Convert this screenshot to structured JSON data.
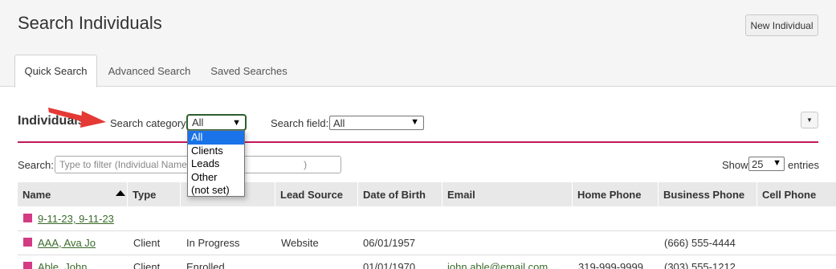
{
  "header": {
    "title": "Search Individuals",
    "new_button": "New Individual"
  },
  "tabs": [
    "Quick Search",
    "Advanced Search",
    "Saved Searches"
  ],
  "section": {
    "title": "Individuals",
    "category_label": "Search category:",
    "category_value": "All",
    "field_label": "Search field:",
    "field_value": "All"
  },
  "category_options": [
    "All",
    "Clients",
    "Leads",
    "Other",
    "(not set)"
  ],
  "filter": {
    "label": "Search:",
    "placeholder_visible_start": "Type to filter (Individual Name,",
    "placeholder_visible_end": ")",
    "show_label": "Show",
    "entries_value": "25",
    "entries_label": "entries"
  },
  "columns": [
    "Name",
    "Type",
    "",
    "Lead Source",
    "Date of Birth",
    "Email",
    "Home Phone",
    "Business Phone",
    "Cell Phone"
  ],
  "rows": [
    {
      "name": "9-11-23, 9-11-23",
      "type": "",
      "status": "",
      "lead_source": "",
      "dob": "",
      "email": "",
      "home": "",
      "business": "",
      "cell": ""
    },
    {
      "name": "AAA, Ava Jo",
      "type": "Client",
      "status": "In Progress",
      "lead_source": "Website",
      "dob": "06/01/1957",
      "email": "",
      "home": "",
      "business": "(666) 555-4444",
      "cell": ""
    },
    {
      "name": "Able, John",
      "type": "Client",
      "status": "Enrolled",
      "lead_source": "",
      "dob": "01/01/1970",
      "email": "john.able@email.com",
      "home": "319-999-9999",
      "business": "(303) 555-1212",
      "cell": ""
    }
  ],
  "colors": {
    "accent_rule": "#c2185b",
    "tag_square": "#d33b83",
    "link": "#3a6b2a",
    "arrow": "#e53935",
    "selected_option": "#1a73e8"
  }
}
